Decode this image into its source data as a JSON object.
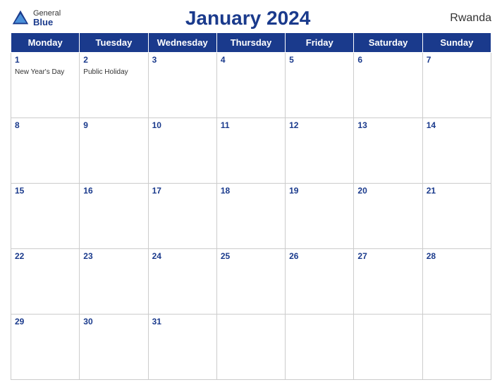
{
  "header": {
    "logo_general": "General",
    "logo_blue": "Blue",
    "title": "January 2024",
    "country": "Rwanda"
  },
  "weekdays": [
    "Monday",
    "Tuesday",
    "Wednesday",
    "Thursday",
    "Friday",
    "Saturday",
    "Sunday"
  ],
  "weeks": [
    {
      "days": [
        {
          "num": "1",
          "event": "New Year's Day"
        },
        {
          "num": "2",
          "event": "Public Holiday"
        },
        {
          "num": "3",
          "event": ""
        },
        {
          "num": "4",
          "event": ""
        },
        {
          "num": "5",
          "event": ""
        },
        {
          "num": "6",
          "event": ""
        },
        {
          "num": "7",
          "event": ""
        }
      ]
    },
    {
      "days": [
        {
          "num": "8",
          "event": ""
        },
        {
          "num": "9",
          "event": ""
        },
        {
          "num": "10",
          "event": ""
        },
        {
          "num": "11",
          "event": ""
        },
        {
          "num": "12",
          "event": ""
        },
        {
          "num": "13",
          "event": ""
        },
        {
          "num": "14",
          "event": ""
        }
      ]
    },
    {
      "days": [
        {
          "num": "15",
          "event": ""
        },
        {
          "num": "16",
          "event": ""
        },
        {
          "num": "17",
          "event": ""
        },
        {
          "num": "18",
          "event": ""
        },
        {
          "num": "19",
          "event": ""
        },
        {
          "num": "20",
          "event": ""
        },
        {
          "num": "21",
          "event": ""
        }
      ]
    },
    {
      "days": [
        {
          "num": "22",
          "event": ""
        },
        {
          "num": "23",
          "event": ""
        },
        {
          "num": "24",
          "event": ""
        },
        {
          "num": "25",
          "event": ""
        },
        {
          "num": "26",
          "event": ""
        },
        {
          "num": "27",
          "event": ""
        },
        {
          "num": "28",
          "event": ""
        }
      ]
    },
    {
      "days": [
        {
          "num": "29",
          "event": ""
        },
        {
          "num": "30",
          "event": ""
        },
        {
          "num": "31",
          "event": ""
        },
        {
          "num": "",
          "event": ""
        },
        {
          "num": "",
          "event": ""
        },
        {
          "num": "",
          "event": ""
        },
        {
          "num": "",
          "event": ""
        }
      ]
    }
  ]
}
